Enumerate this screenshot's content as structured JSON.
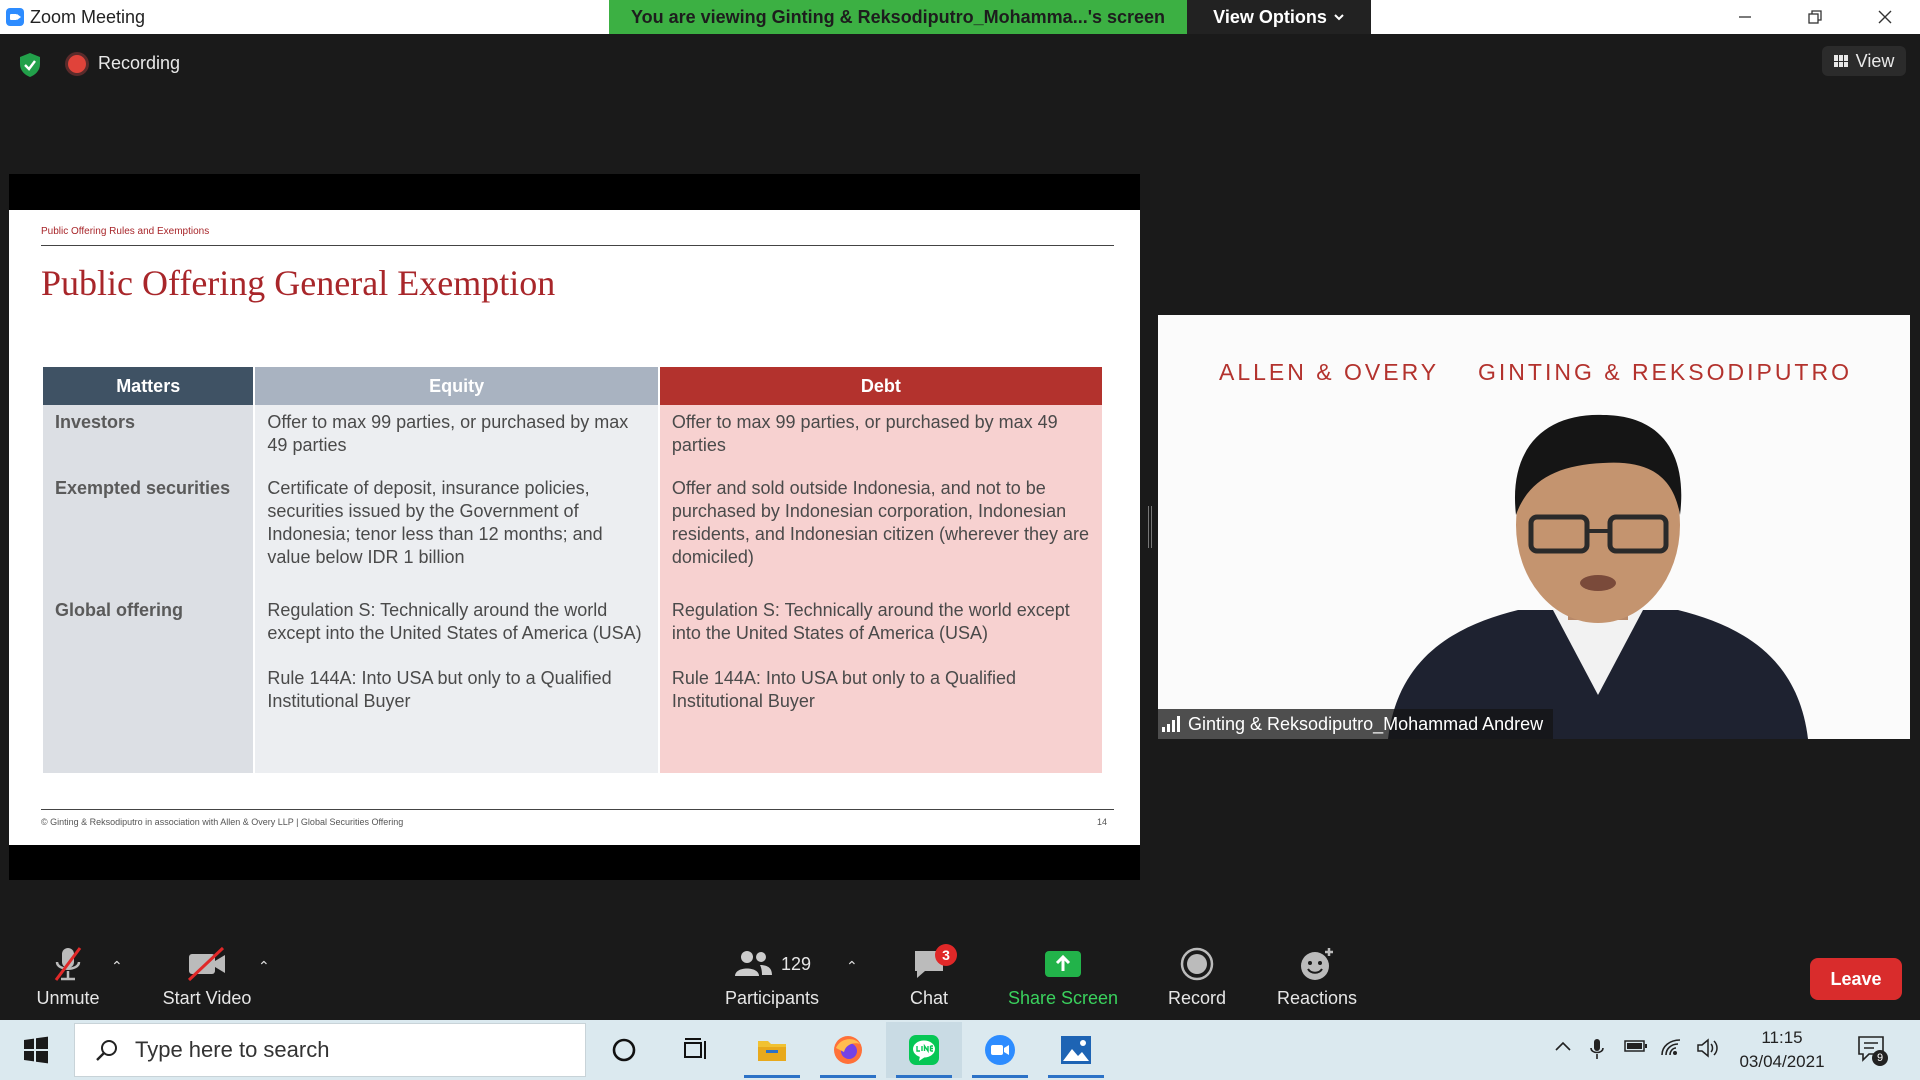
{
  "window": {
    "title": "Zoom Meeting",
    "share_banner": "You are viewing Ginting & Reksodiputro_Mohamma...'s screen",
    "view_options_label": "View Options"
  },
  "meeting_bar": {
    "recording_label": "Recording",
    "view_label": "View"
  },
  "slide": {
    "kicker": "Public Offering Rules and Exemptions",
    "title": "Public Offering General Exemption",
    "table": {
      "headers": [
        "Matters",
        "Equity",
        "Debt"
      ],
      "rows": [
        {
          "matter": "Investors",
          "equity": [
            "Offer to max 99 parties, or purchased by max 49 parties"
          ],
          "debt": [
            "Offer to max 99 parties, or purchased by max 49 parties"
          ]
        },
        {
          "matter": "Exempted securities",
          "equity": [
            "Certificate of deposit, insurance policies, securities issued by the Government of Indonesia; tenor less than 12 months; and value below IDR 1 billion"
          ],
          "debt": [
            "Offer and sold outside Indonesia, and not to be purchased by Indonesian corporation, Indonesian residents, and Indonesian citizen (wherever they are domiciled)"
          ]
        },
        {
          "matter": "Global offering",
          "equity": [
            "Regulation S: Technically around the world except into the United States of America (USA)",
            "Rule 144A: Into USA but only to a Qualified Institutional Buyer"
          ],
          "debt": [
            "Regulation S: Technically around the world except into the United States of America (USA)",
            "Rule 144A: Into USA but only to a Qualified Institutional Buyer"
          ]
        }
      ]
    },
    "footer": "© Ginting & Reksodiputro in association with Allen & Overy LLP | Global Securities Offering",
    "page_number": "14"
  },
  "video": {
    "brand_left": "ALLEN & OVERY",
    "brand_right": "GINTING & REKSODIPUTRO",
    "participant_name": "Ginting & Reksodiputro_Mohammad Andrew"
  },
  "controls": {
    "unmute": "Unmute",
    "start_video": "Start Video",
    "participants": "Participants",
    "participant_count": "129",
    "chat": "Chat",
    "chat_badge": "3",
    "share_screen": "Share Screen",
    "record": "Record",
    "reactions": "Reactions",
    "leave": "Leave"
  },
  "taskbar": {
    "search_placeholder": "Type here to search",
    "time": "11:15",
    "date": "03/04/2021",
    "notification_count": "9"
  },
  "colors": {
    "accent_red": "#a8262a",
    "share_green": "#3cb043",
    "leave_red": "#d92c2c",
    "header_dark": "#3f5264",
    "header_equity": "#a9b3c1",
    "header_debt": "#b3322d"
  }
}
